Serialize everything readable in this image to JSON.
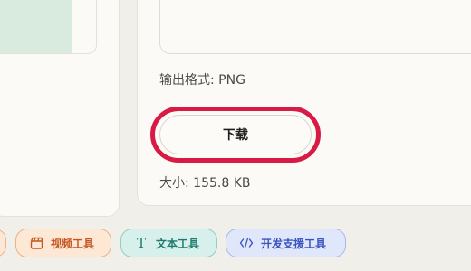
{
  "output": {
    "format_label": "输出格式: PNG",
    "size_label": "大小: 155.8 KB"
  },
  "actions": {
    "download_label": "下载"
  },
  "categories": [
    {
      "label": "视频工具",
      "icon": "video-clapper-icon",
      "color": "#c4561f"
    },
    {
      "label": "文本工具",
      "icon": "text-t-icon",
      "color": "#1d7c70"
    },
    {
      "label": "开发支援工具",
      "icon": "code-brackets-icon",
      "color": "#3b55c0"
    }
  ],
  "highlight_color": "#d81b45"
}
